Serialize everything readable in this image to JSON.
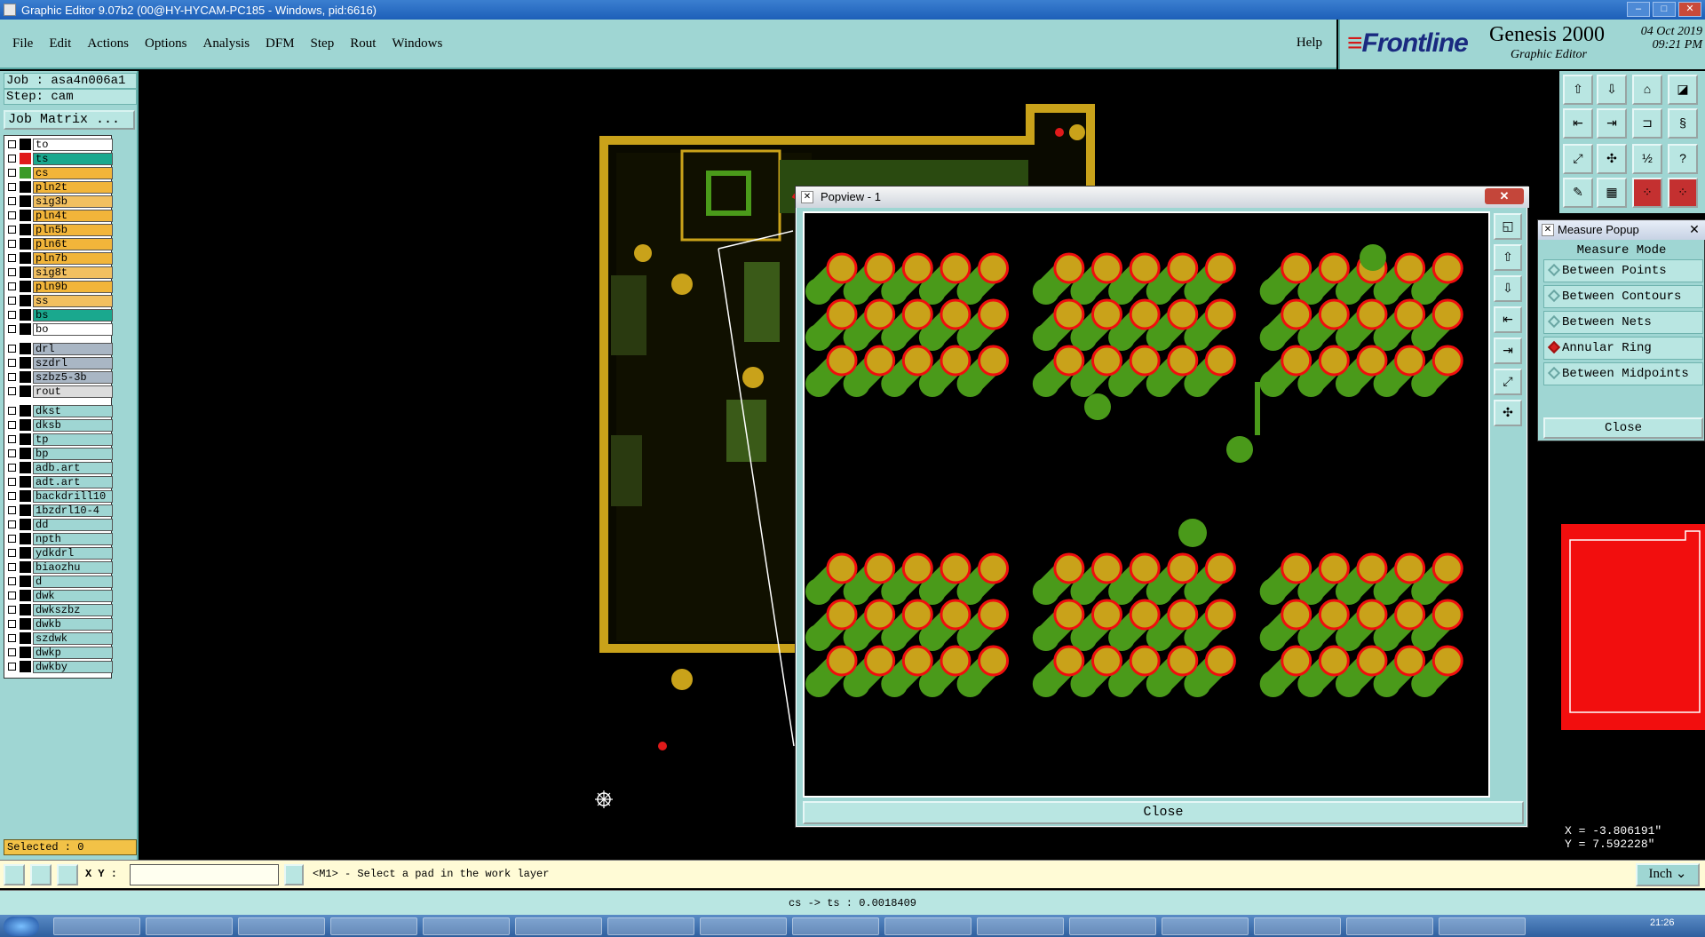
{
  "window": {
    "title": "Graphic Editor 9.07b2 (00@HY-HYCAM-PC185 - Windows, pid:6616)"
  },
  "menu": {
    "items": [
      "File",
      "Edit",
      "Actions",
      "Options",
      "Analysis",
      "DFM",
      "Step",
      "Rout",
      "Windows"
    ],
    "help": "Help"
  },
  "brand": {
    "logo": "Frontline",
    "product": "Genesis 2000",
    "subtitle": "Graphic Editor",
    "date": "04 Oct 2019",
    "time": "09:21 PM"
  },
  "left_panel": {
    "job": "Job : asa4n006a1",
    "step": "Step: cam",
    "job_matrix": "Job Matrix ...",
    "selected": "Selected : 0"
  },
  "layers": [
    {
      "name": "to",
      "color": "#ffffff",
      "swatch": "#000000"
    },
    {
      "name": "ts",
      "color": "#1aa88e",
      "swatch": "#e01a1a"
    },
    {
      "name": "cs",
      "color": "#f2b53a",
      "swatch": "#3a9a28"
    },
    {
      "name": "pln2t",
      "color": "#f2b53a",
      "swatch": "#000000"
    },
    {
      "name": "sig3b",
      "color": "#f2c060",
      "swatch": "#000000"
    },
    {
      "name": "pln4t",
      "color": "#f2b53a",
      "swatch": "#000000"
    },
    {
      "name": "pln5b",
      "color": "#f2b53a",
      "swatch": "#000000"
    },
    {
      "name": "pln6t",
      "color": "#f2b53a",
      "swatch": "#000000"
    },
    {
      "name": "pln7b",
      "color": "#f2b53a",
      "swatch": "#000000"
    },
    {
      "name": "sig8t",
      "color": "#f2c060",
      "swatch": "#000000"
    },
    {
      "name": "pln9b",
      "color": "#f2b53a",
      "swatch": "#000000"
    },
    {
      "name": "ss",
      "color": "#f2c060",
      "swatch": "#000000"
    },
    {
      "name": "bs",
      "color": "#1aa88e",
      "swatch": "#000000"
    },
    {
      "name": "bo",
      "color": "#ffffff",
      "swatch": "#000000"
    },
    {
      "name": "drl",
      "color": "#a9b6c4",
      "swatch": "#000000"
    },
    {
      "name": "szdrl",
      "color": "#a9b6c4",
      "swatch": "#000000"
    },
    {
      "name": "szbz5-3b",
      "color": "#a9b6c4",
      "swatch": "#000000"
    },
    {
      "name": "rout",
      "color": "#dcdcdc",
      "swatch": "#000000"
    },
    {
      "name": "dkst",
      "color": "#9fd6d3",
      "swatch": "#000000"
    },
    {
      "name": "dksb",
      "color": "#9fd6d3",
      "swatch": "#000000"
    },
    {
      "name": "tp",
      "color": "#9fd6d3",
      "swatch": "#000000"
    },
    {
      "name": "bp",
      "color": "#9fd6d3",
      "swatch": "#000000"
    },
    {
      "name": "adb.art",
      "color": "#9fd6d3",
      "swatch": "#000000"
    },
    {
      "name": "adt.art",
      "color": "#9fd6d3",
      "swatch": "#000000"
    },
    {
      "name": "backdrill10",
      "color": "#9fd6d3",
      "swatch": "#000000"
    },
    {
      "name": "1bzdrl10-4",
      "color": "#9fd6d3",
      "swatch": "#000000"
    },
    {
      "name": "dd",
      "color": "#9fd6d3",
      "swatch": "#000000"
    },
    {
      "name": "npth",
      "color": "#9fd6d3",
      "swatch": "#000000"
    },
    {
      "name": "ydkdrl",
      "color": "#9fd6d3",
      "swatch": "#000000"
    },
    {
      "name": "biaozhu",
      "color": "#9fd6d3",
      "swatch": "#000000"
    },
    {
      "name": "d",
      "color": "#9fd6d3",
      "swatch": "#000000"
    },
    {
      "name": "dwk",
      "color": "#9fd6d3",
      "swatch": "#000000"
    },
    {
      "name": "dwkszbz",
      "color": "#9fd6d3",
      "swatch": "#000000"
    },
    {
      "name": "dwkb",
      "color": "#9fd6d3",
      "swatch": "#000000"
    },
    {
      "name": "szdwk",
      "color": "#9fd6d3",
      "swatch": "#000000"
    },
    {
      "name": "dwkp",
      "color": "#9fd6d3",
      "swatch": "#000000"
    },
    {
      "name": "dwkby",
      "color": "#9fd6d3",
      "swatch": "#000000"
    }
  ],
  "popview": {
    "title": "Popview - 1",
    "close": "Close"
  },
  "measure": {
    "title": "Measure Popup",
    "mode_label": "Measure Mode",
    "options": [
      {
        "label": "Between Points",
        "selected": false
      },
      {
        "label": "Between Contours",
        "selected": false
      },
      {
        "label": "Between Nets",
        "selected": false
      },
      {
        "label": "Annular Ring",
        "selected": true
      },
      {
        "label": "Between Midpoints",
        "selected": false
      }
    ],
    "close": "Close"
  },
  "coords": {
    "x": "X = -3.806191\"",
    "y": "Y = 7.592228\""
  },
  "bottom": {
    "xy_label": "X Y :",
    "xy_value": "",
    "prompt": "<M1> - Select a pad in the work layer",
    "unit": "Inch"
  },
  "status": {
    "text": "cs -> ts : 0.0018409"
  },
  "taskbar": {
    "clock": "21:26"
  },
  "colors": {
    "panel": "#9fd6d3",
    "pad_copper": "#c9a21a",
    "pad_ring": "#f00e0e",
    "trace_green": "#4a9a1a"
  }
}
